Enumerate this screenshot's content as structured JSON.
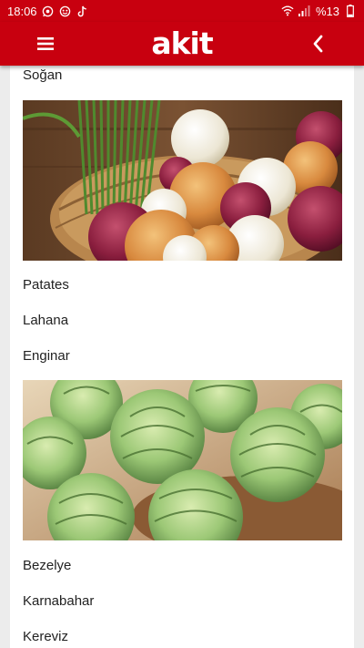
{
  "status_bar": {
    "time": "18:06",
    "battery": "%13",
    "left_icons": [
      "whatsapp-icon",
      "messenger-icon",
      "tiktok-icon"
    ],
    "right_icons": [
      "wifi-icon",
      "signal-icon",
      "battery-icon"
    ]
  },
  "header": {
    "logo_text": "akit",
    "background_color": "#c8000f",
    "menu_icon": "hamburger-menu-icon",
    "back_icon": "chevron-left-icon"
  },
  "list": {
    "items": [
      "Soğan",
      "Patates",
      "Lahana",
      "Enginar",
      "Bezelye",
      "Karnabahar",
      "Kereviz"
    ]
  },
  "images": {
    "onion_photo": "onions-in-basket",
    "artichoke_photo": "artichokes-in-basket"
  }
}
